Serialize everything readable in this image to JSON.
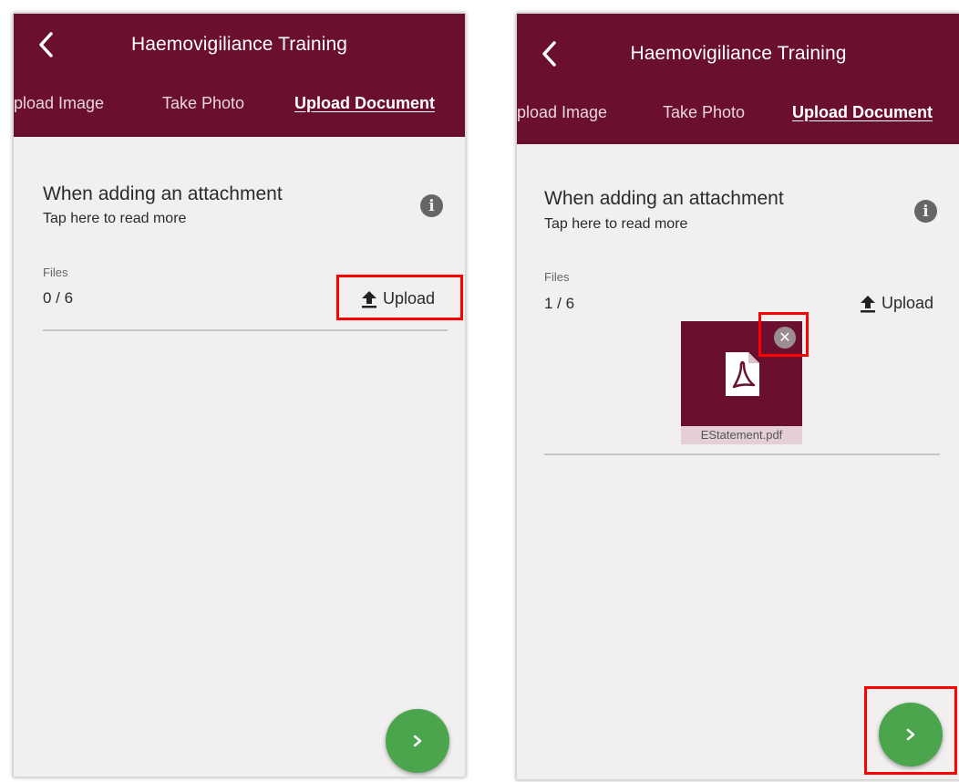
{
  "screens": [
    {
      "header": {
        "title": "Haemovigiliance Training"
      },
      "tabs": [
        "pload Image",
        "Take Photo",
        "Upload Document"
      ],
      "info": {
        "title": "When adding an attachment",
        "subtitle": "Tap here to read more",
        "icon": "info-icon"
      },
      "files": {
        "label": "Files",
        "count": "0 / 6",
        "upload_label": "Upload"
      },
      "attachments": []
    },
    {
      "header": {
        "title": "Haemovigiliance Training"
      },
      "tabs": [
        "pload Image",
        "Take Photo",
        "Upload Document"
      ],
      "info": {
        "title": "When adding an attachment",
        "subtitle": "Tap here to read more",
        "icon": "info-icon"
      },
      "files": {
        "label": "Files",
        "count": "1 / 6",
        "upload_label": "Upload"
      },
      "attachments": [
        {
          "name": "EStatement.pdf",
          "icon": "pdf-file-icon"
        }
      ]
    }
  ],
  "colors": {
    "header": "#6a0f30",
    "background": "#f1eff0",
    "fab": "#4aa54d",
    "highlight": "#ff0000"
  }
}
